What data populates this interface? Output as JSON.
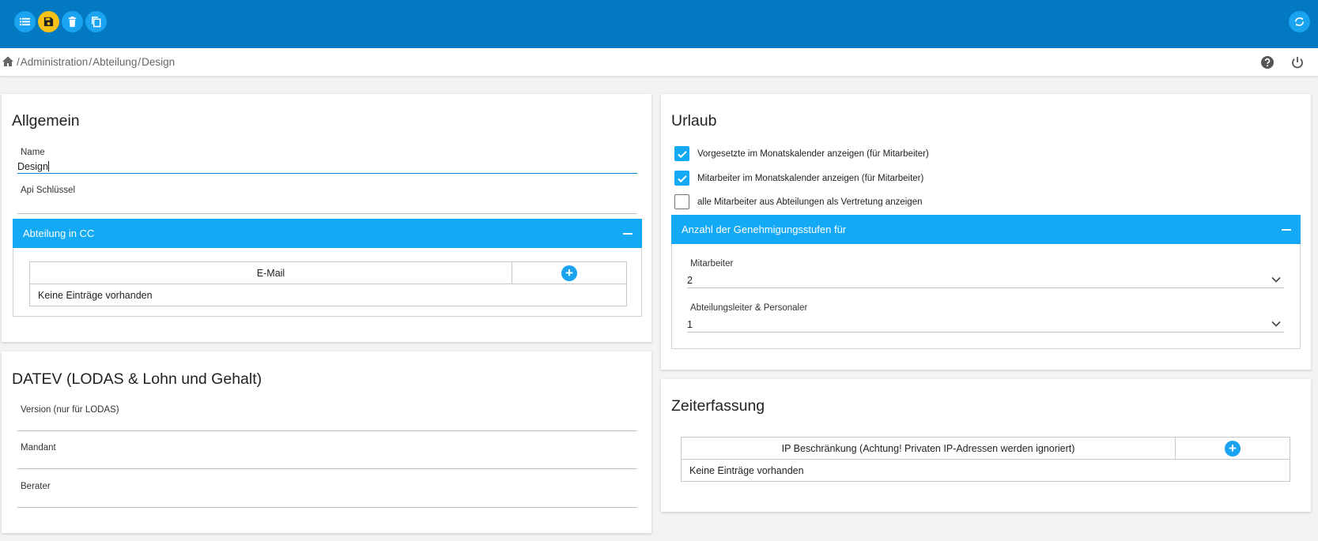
{
  "toolbar": {
    "colors": {
      "bar": "#0279c1",
      "button": "#1aa3f0",
      "save_button": "#f6c21a"
    }
  },
  "breadcrumb": {
    "items": [
      "Administration",
      "Abteilung",
      "Design"
    ],
    "separator": "/"
  },
  "allgemein": {
    "title": "Allgemein",
    "name_label": "Name",
    "name_value": "Design",
    "api_label": "Api Schlüssel",
    "api_value": "",
    "cc_panel": {
      "title": "Abteilung in CC",
      "column": "E-Mail",
      "empty": "Keine Einträge vorhanden"
    }
  },
  "datev": {
    "title": "DATEV (LODAS & Lohn und Gehalt)",
    "fields": [
      {
        "label": "Version (nur für LODAS)",
        "value": ""
      },
      {
        "label": "Mandant",
        "value": ""
      },
      {
        "label": "Berater",
        "value": ""
      }
    ]
  },
  "urlaub": {
    "title": "Urlaub",
    "checkboxes": [
      {
        "label": "Vorgesetzte im Monatskalender anzeigen (für Mitarbeiter)",
        "checked": true
      },
      {
        "label": "Mitarbeiter im Monatskalender anzeigen (für Mitarbeiter)",
        "checked": true
      },
      {
        "label": "alle Mitarbeiter aus Abteilungen als Vertretung anzeigen",
        "checked": false
      }
    ],
    "approval_panel": {
      "title": "Anzahl der Genehmigungsstufen für",
      "mitarbeiter_label": "Mitarbeiter",
      "mitarbeiter_value": "2",
      "leiter_label": "Abteilungsleiter & Personaler",
      "leiter_value": "1"
    }
  },
  "zeiterfassung": {
    "title": "Zeiterfassung",
    "column": "IP Beschränkung (Achtung! Privaten IP-Adressen werden ignoriert)",
    "empty": "Keine Einträge vorhanden"
  }
}
